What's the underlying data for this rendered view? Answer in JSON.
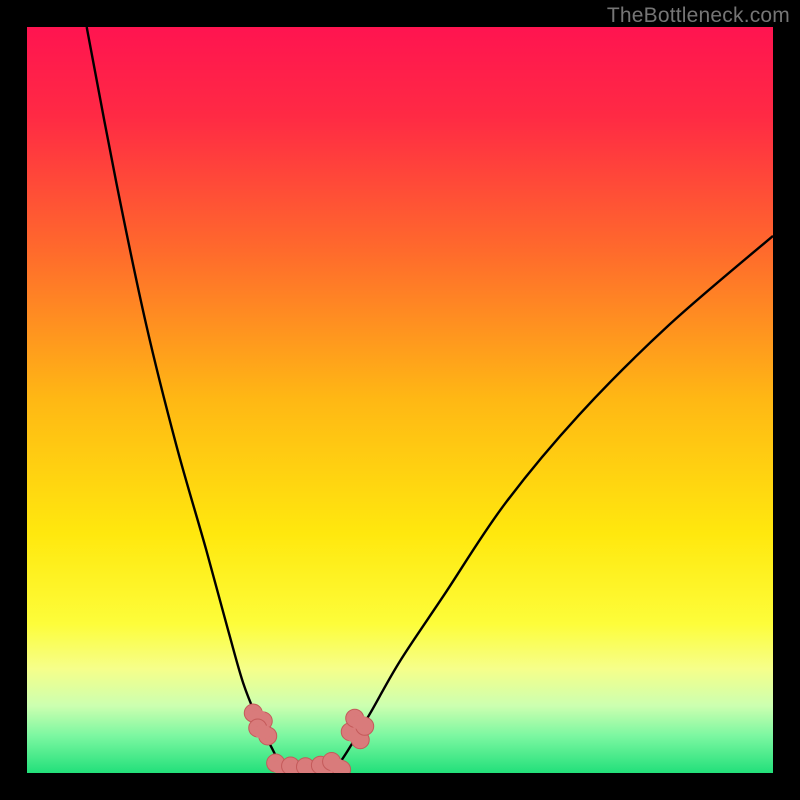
{
  "watermark": "TheBottleneck.com",
  "colors": {
    "black": "#000000",
    "curve": "#000000",
    "marker_fill": "#d97b7b",
    "marker_stroke": "#c45a5a",
    "gradient_stops": [
      {
        "offset": 0.0,
        "color": "#ff1450"
      },
      {
        "offset": 0.12,
        "color": "#ff2a44"
      },
      {
        "offset": 0.3,
        "color": "#ff6a2c"
      },
      {
        "offset": 0.5,
        "color": "#ffb814"
      },
      {
        "offset": 0.68,
        "color": "#ffe80e"
      },
      {
        "offset": 0.8,
        "color": "#fdfd3a"
      },
      {
        "offset": 0.86,
        "color": "#f6ff8a"
      },
      {
        "offset": 0.91,
        "color": "#ccffb0"
      },
      {
        "offset": 0.95,
        "color": "#7cf7a1"
      },
      {
        "offset": 1.0,
        "color": "#22e07a"
      }
    ]
  },
  "chart_data": {
    "type": "line",
    "title": "",
    "xlabel": "",
    "ylabel": "",
    "xlim": [
      0,
      100
    ],
    "ylim": [
      0,
      100
    ],
    "series": [
      {
        "name": "left-branch",
        "x": [
          8,
          12,
          16,
          20,
          24,
          27,
          29,
          31,
          33,
          34.5
        ],
        "y": [
          100,
          79,
          60,
          44,
          30,
          19,
          12,
          7,
          3,
          0
        ]
      },
      {
        "name": "right-branch",
        "x": [
          41,
          43,
          46,
          50,
          56,
          64,
          74,
          86,
          100
        ],
        "y": [
          0,
          3,
          8,
          15,
          24,
          36,
          48,
          60,
          72
        ]
      }
    ],
    "floor_segment": {
      "x": [
        34.5,
        41
      ],
      "y": [
        0,
        0
      ]
    },
    "markers": [
      {
        "x": 31.0,
        "y": 7.5
      },
      {
        "x": 31.6,
        "y": 5.5
      },
      {
        "x": 34.0,
        "y": 0.8
      },
      {
        "x": 36.0,
        "y": 0.4
      },
      {
        "x": 38.0,
        "y": 0.3
      },
      {
        "x": 40.0,
        "y": 0.5
      },
      {
        "x": 41.5,
        "y": 1.0
      },
      {
        "x": 44.0,
        "y": 5.0
      },
      {
        "x": 44.6,
        "y": 6.8
      }
    ]
  }
}
